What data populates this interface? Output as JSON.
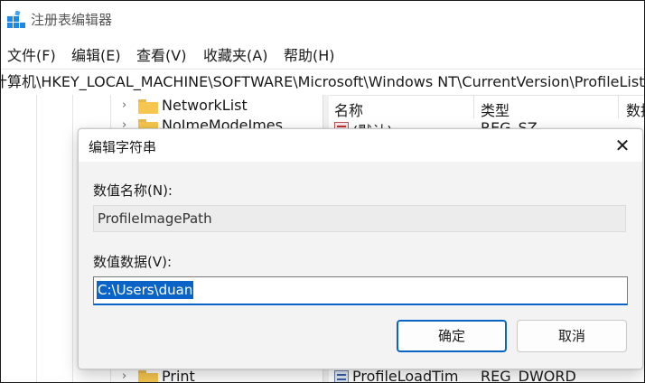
{
  "window": {
    "title": "注册表编辑器",
    "icon": "regedit-icon"
  },
  "menu": [
    "文件(F)",
    "编辑(E)",
    "查看(V)",
    "收藏夹(A)",
    "帮助(H)"
  ],
  "address": "计算机\\HKEY_LOCAL_MACHINE\\SOFTWARE\\Microsoft\\Windows NT\\CurrentVersion\\ProfileList",
  "tree": {
    "items": [
      {
        "label": "NetworkList"
      },
      {
        "label": "NoImeModeImes"
      },
      {
        "label": "Print"
      }
    ]
  },
  "list": {
    "columns": [
      "名称",
      "类型",
      "数据"
    ],
    "rows": [
      {
        "name": "(默认)",
        "type": "REG_SZ"
      },
      {
        "name": "ProfileLoadTim",
        "type": "REG_DWORD"
      }
    ]
  },
  "dialog": {
    "title": "编辑字符串",
    "close_glyph": "✕",
    "name_label": "数值名称(N):",
    "name_value": "ProfileImagePath",
    "data_label": "数值数据(V):",
    "data_value": "C:\\Users\\duan",
    "ok_label": "确定",
    "cancel_label": "取消"
  },
  "colors": {
    "accent": "#0a64c8",
    "folder": "#f6c64e"
  }
}
